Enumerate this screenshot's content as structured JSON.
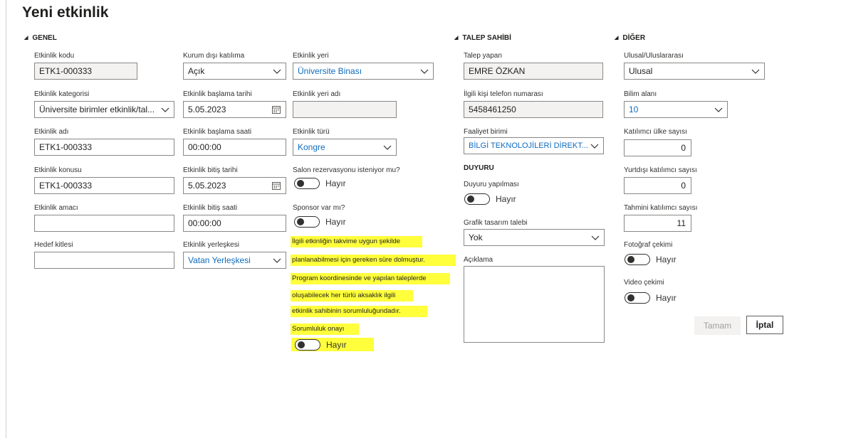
{
  "title": "Yeni etkinlik",
  "sections": {
    "genel": "GENEL",
    "talep_sahibi": "TALEP SAHİBİ",
    "diger": "DİĞER",
    "duyuru": "DUYURU"
  },
  "fields": {
    "etkinlik_kodu": {
      "label": "Etkinlik kodu",
      "value": "ETK1-000333"
    },
    "etkinlik_kategorisi": {
      "label": "Etkinlik kategorisi",
      "value": "Üniversite birimler etkinlik/tal..."
    },
    "etkinlik_adi": {
      "label": "Etkinlik adı",
      "value": "ETK1-000333"
    },
    "etkinlik_konusu": {
      "label": "Etkinlik konusu",
      "value": "ETK1-000333"
    },
    "etkinlik_amaci": {
      "label": "Etkinlik amacı",
      "value": ""
    },
    "hedef_kitlesi": {
      "label": "Hedef kitlesi",
      "value": ""
    },
    "kurum_disi": {
      "label": "Kurum dışı katılıma",
      "value": "Açık"
    },
    "baslama_tarihi": {
      "label": "Etkinlik başlama tarihi",
      "value": "5.05.2023"
    },
    "baslama_saati": {
      "label": "Etkinlik başlama saati",
      "value": "00:00:00"
    },
    "bitis_tarihi": {
      "label": "Etkinlik bitiş tarihi",
      "value": "5.05.2023"
    },
    "bitis_saati": {
      "label": "Etkinlik bitiş saati",
      "value": "00:00:00"
    },
    "yerleskesi": {
      "label": "Etkinlik yerleşkesi",
      "value": "Vatan Yerleşkesi"
    },
    "etkinlik_yeri": {
      "label": "Etkinlik yeri",
      "value": "Üniversite Binası"
    },
    "etkinlik_yeri_adi": {
      "label": "Etkinlik yeri adı",
      "value": ""
    },
    "etkinlik_turu": {
      "label": "Etkinlik türü",
      "value": "Kongre"
    },
    "salon": {
      "label": "Salon rezervasyonu isteniyor mu?",
      "value": "Hayır"
    },
    "sponsor": {
      "label": "Sponsor var mı?",
      "value": "Hayır"
    },
    "talep_yapan": {
      "label": "Talep yapan",
      "value": "EMRE ÖZKAN"
    },
    "telefon": {
      "label": "İlgili kişi telefon numarası",
      "value": "5458461250"
    },
    "faaliyet_birimi": {
      "label": "Faaliyet birimi",
      "value": "BİLGİ TEKNOLOJİLERİ DİREKT..."
    },
    "duyuru_yapilmasi": {
      "label": "Duyuru yapılması",
      "value": "Hayır"
    },
    "grafik": {
      "label": "Grafik tasarım talebi",
      "value": "Yok"
    },
    "aciklama": {
      "label": "Açıklama",
      "value": ""
    },
    "ulusal": {
      "label": "Ulusal/Uluslararası",
      "value": "Ulusal"
    },
    "bilim_alani": {
      "label": "Bilim alanı",
      "value": "10"
    },
    "ulke_sayisi": {
      "label": "Katılımcı ülke sayısı",
      "value": "0"
    },
    "yurtdisi": {
      "label": "Yurtdışı katılımcı sayısı",
      "value": "0"
    },
    "tahmini": {
      "label": "Tahmini katılımcı sayısı",
      "value": "11"
    },
    "fotograf": {
      "label": "Fotoğraf çekimi",
      "value": "Hayır"
    },
    "video": {
      "label": "Video çekimi",
      "value": "Hayır"
    }
  },
  "notice": {
    "lines": [
      "İlgili etkinliğin takvime uygun şekilde",
      "planlanabilmesi için gereken süre dolmuştur.",
      "Program koordinesinde ve yapılan taleplerde",
      "oluşabilecek her türlü aksaklık ilgili",
      "etkinlik sahibinin sorumluluğundadır."
    ],
    "onay_label": "Sorumluluk onayı",
    "onay_value": "Hayır",
    "highlight_color": "#ffff3c"
  },
  "buttons": {
    "ok": "Tamam",
    "cancel": "İptal"
  }
}
